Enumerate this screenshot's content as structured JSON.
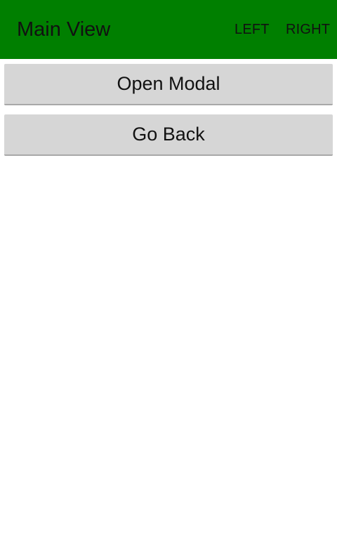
{
  "app_bar": {
    "title": "Main View",
    "left_action": "LEFT",
    "right_action": "RIGHT",
    "background_color": "#007f00"
  },
  "buttons": {
    "open_modal": "Open Modal",
    "go_back": "Go Back",
    "background_color": "#d6d6d6"
  }
}
